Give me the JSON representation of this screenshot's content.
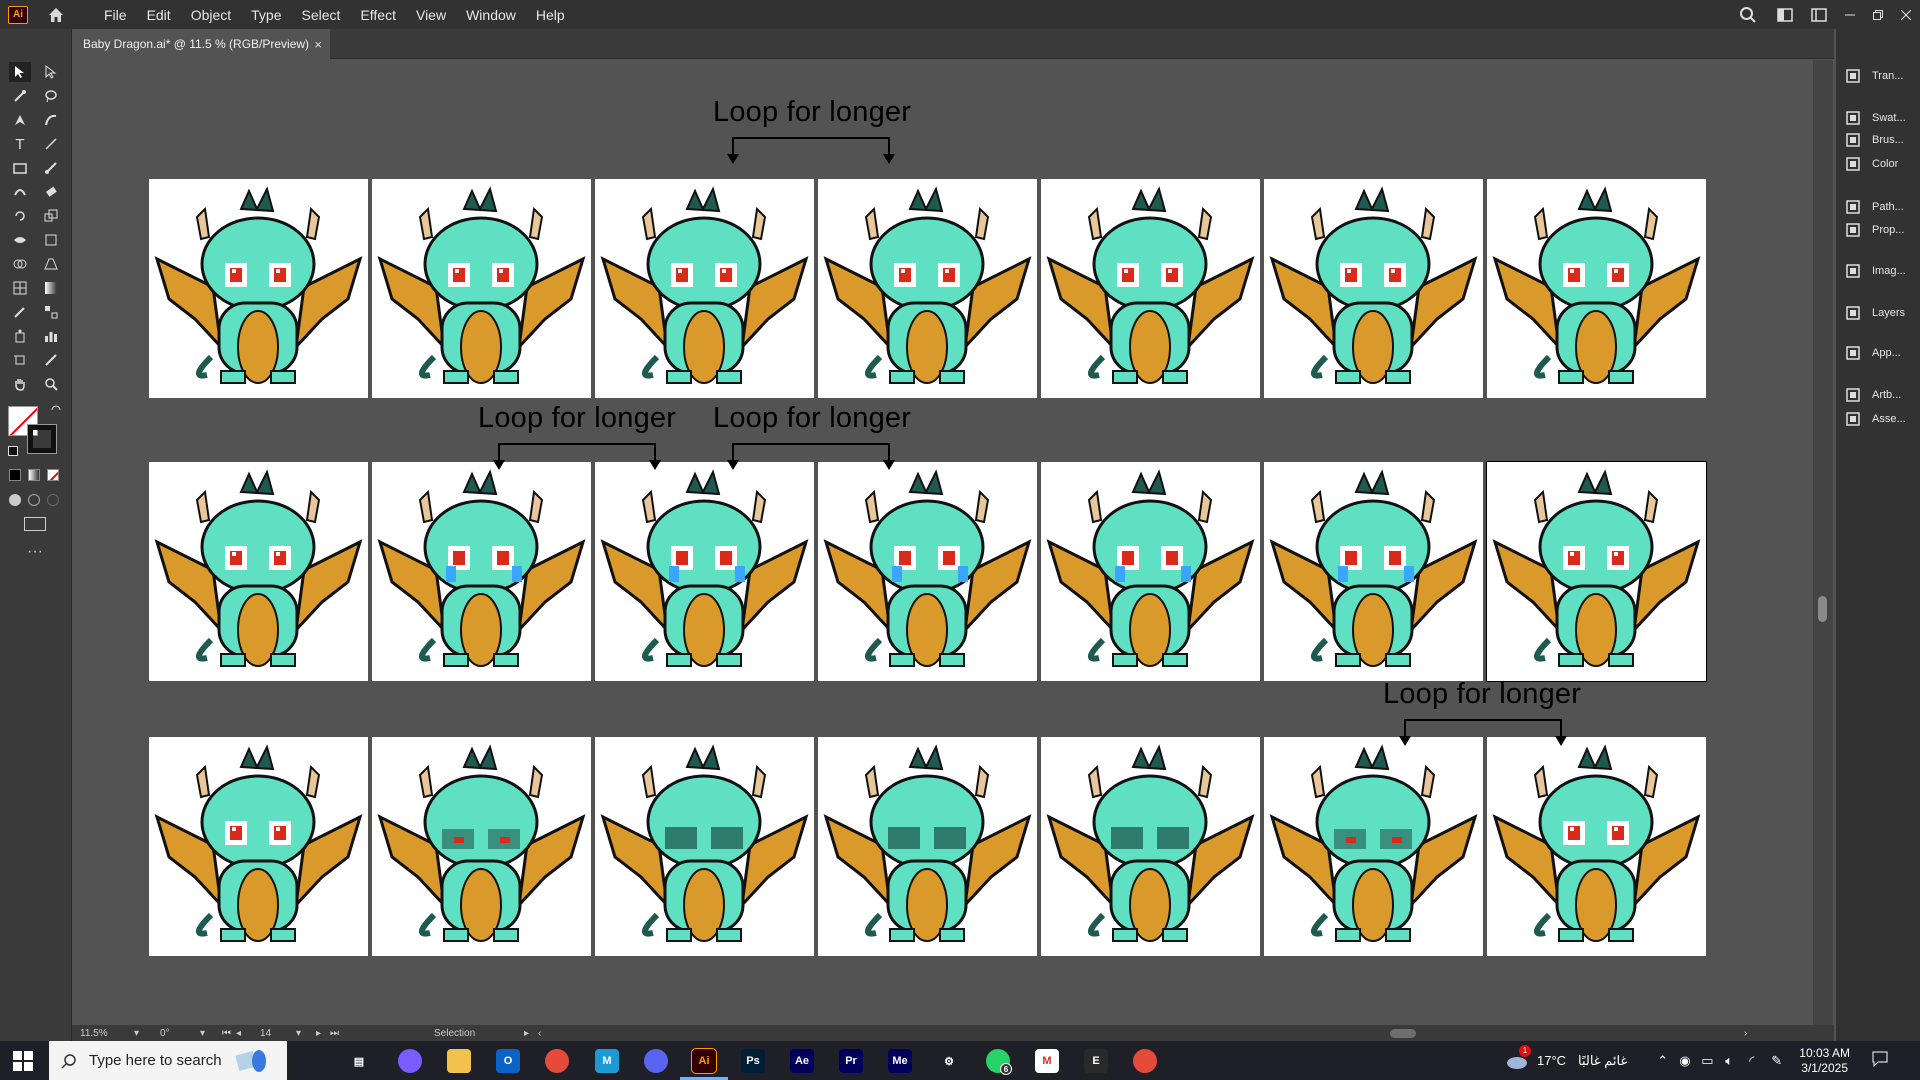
{
  "menubar": {
    "app_logo": "Ai",
    "items": [
      "File",
      "Edit",
      "Object",
      "Type",
      "Select",
      "Effect",
      "View",
      "Window",
      "Help"
    ]
  },
  "document_tab": {
    "title": "Baby Dragon.ai* @ 11.5 % (RGB/Preview)",
    "close": "×"
  },
  "canvas": {
    "annotations": [
      "Loop for longer",
      "Loop for longer",
      "Loop for longer",
      "Loop for longer"
    ],
    "rows": [
      {
        "frames": 7
      },
      {
        "frames": 7
      },
      {
        "frames": 7
      }
    ]
  },
  "right_panel": {
    "items": [
      {
        "label": "Tran...",
        "icon": "transform-icon"
      },
      {
        "label": "Swat...",
        "icon": "swatches-icon"
      },
      {
        "label": "Brus...",
        "icon": "brushes-icon"
      },
      {
        "label": "Color",
        "icon": "color-icon"
      },
      {
        "label": "Path...",
        "icon": "pathfinder-icon"
      },
      {
        "label": "Prop...",
        "icon": "properties-icon"
      },
      {
        "label": "Imag...",
        "icon": "image-trace-icon"
      },
      {
        "label": "Layers",
        "icon": "layers-icon"
      },
      {
        "label": "App...",
        "icon": "appearance-icon"
      },
      {
        "label": "Artb...",
        "icon": "artboards-icon"
      },
      {
        "label": "Asse...",
        "icon": "asset-export-icon"
      }
    ]
  },
  "statusbar": {
    "zoom": "11.5%",
    "rotation": "0°",
    "artboard_number": "14",
    "tool": "Selection"
  },
  "taskbar": {
    "search_placeholder": "Type here to search",
    "weather_temp": "17°C",
    "weather_text": "غائم غالبًا",
    "time": "10:03 AM",
    "date": "3/1/2025",
    "whatsapp_badge": "6",
    "weather_badge": "1"
  },
  "colors": {
    "dragon_body": "#5fe0c3",
    "dragon_wing": "#d99a2b",
    "dragon_dark": "#1f5a50",
    "eye": "#d92a1a",
    "ai_orange": "#ff9a00"
  }
}
